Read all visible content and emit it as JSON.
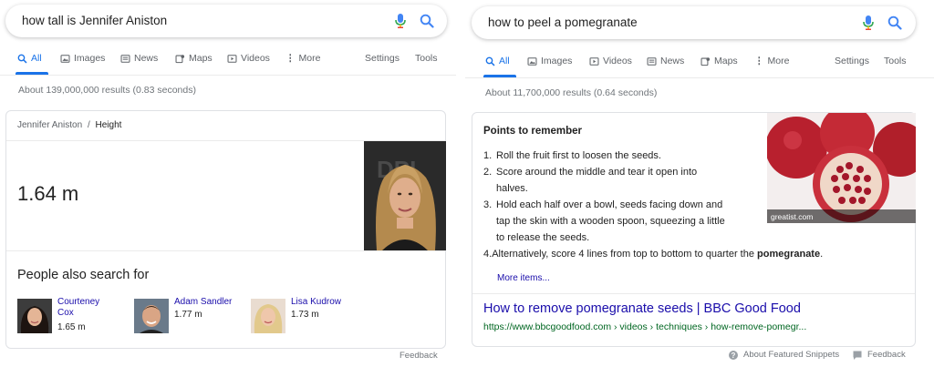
{
  "left": {
    "search": {
      "query": "how tall is Jennifer Aniston"
    },
    "tabs": [
      {
        "label": "All",
        "icon": "search-icon",
        "active": true
      },
      {
        "label": "Images",
        "icon": "image-icon"
      },
      {
        "label": "News",
        "icon": "news-icon"
      },
      {
        "label": "Maps",
        "icon": "map-icon"
      },
      {
        "label": "Videos",
        "icon": "video-icon"
      },
      {
        "label": "More",
        "icon": "more-vert-icon"
      }
    ],
    "tools": {
      "settings": "Settings",
      "tools": "Tools"
    },
    "stats": "About 139,000,000 results (0.83 seconds)",
    "kp": {
      "breadcrumb_entity": "Jennifer Aniston",
      "breadcrumb_sep": "/",
      "breadcrumb_attr": "Height",
      "answer": "1.64 m",
      "also_title": "People also search for",
      "people": [
        {
          "name_line1": "Courteney",
          "name_line2": "Cox",
          "height": "1.65 m"
        },
        {
          "name_line1": "Adam Sandler",
          "name_line2": "",
          "height": "1.77 m"
        },
        {
          "name_line1": "Lisa Kudrow",
          "name_line2": "",
          "height": "1.73 m"
        }
      ]
    },
    "feedback": "Feedback"
  },
  "right": {
    "search": {
      "query": "how to peel a pomegranate"
    },
    "tabs": [
      {
        "label": "All",
        "icon": "search-icon",
        "active": true
      },
      {
        "label": "Images",
        "icon": "image-icon"
      },
      {
        "label": "Videos",
        "icon": "video-icon"
      },
      {
        "label": "News",
        "icon": "news-icon"
      },
      {
        "label": "Maps",
        "icon": "map-icon"
      },
      {
        "label": "More",
        "icon": "more-vert-icon"
      }
    ],
    "tools": {
      "settings": "Settings",
      "tools": "Tools"
    },
    "stats": "About 11,700,000 results (0.64 seconds)",
    "snippet": {
      "heading": "Points to remember",
      "steps": [
        {
          "num": "1.",
          "lines": [
            "Roll the fruit first to loosen the seeds."
          ]
        },
        {
          "num": "2.",
          "lines": [
            "Score around the middle and tear it open into",
            "halves."
          ]
        },
        {
          "num": "3.",
          "lines": [
            "Hold each half over a bowl, seeds facing down and",
            "tap the skin with a wooden spoon, squeezing a little",
            "to release the seeds."
          ]
        },
        {
          "num": "4.",
          "pre": "Alternatively, score 4 lines from top to bottom to quarter the ",
          "bold": "pomegranate",
          "post": "."
        }
      ],
      "more": "More items...",
      "image_caption": "greatist.com",
      "result_title": "How to remove pomegranate seeds | BBC Good Food",
      "result_url": "https://www.bbcgoodfood.com › videos › techniques › how-remove-pomegr..."
    },
    "about_snippets": "About Featured Snippets",
    "feedback": "Feedback"
  },
  "colors": {
    "link": "#1a0dab",
    "url_green": "#006621",
    "accent": "#1a73e8",
    "muted": "#70757a"
  }
}
